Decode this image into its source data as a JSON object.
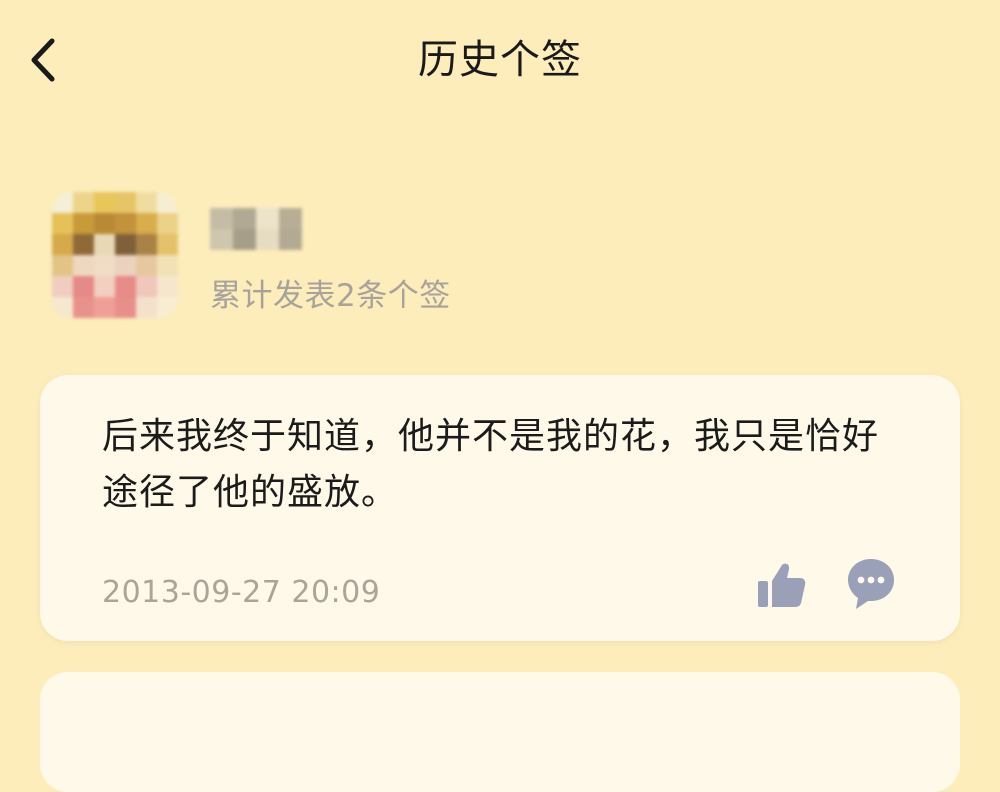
{
  "header": {
    "title": "历史个签"
  },
  "profile": {
    "count_text": "累计发表2条个签"
  },
  "signatures": [
    {
      "text": "后来我终于知道，他并不是我的花，我只是恰好途径了他的盛放。",
      "time": "2013-09-27 20:09"
    }
  ],
  "icons": {
    "back": "chevron-left-icon",
    "like": "thumbs-up-icon",
    "comment": "comment-bubble-icon"
  },
  "colors": {
    "background": "#fcedbb",
    "card": "#fef9e8",
    "icon": "#9aa0b8",
    "muted_text": "#a7a39a"
  }
}
